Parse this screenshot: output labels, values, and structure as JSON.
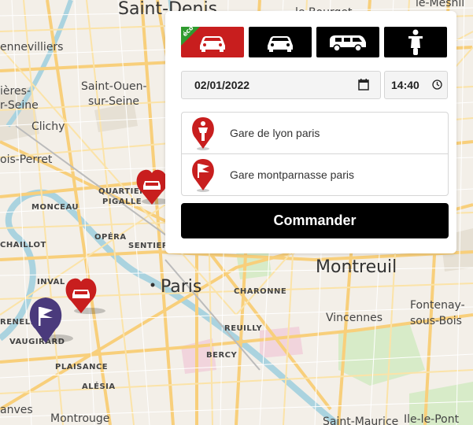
{
  "map": {
    "labels": {
      "saint_denis": "Saint-Denis",
      "bourget": "le Bourget",
      "mesnil": "le-Mesnil",
      "gennevilliers": "ennevilliers",
      "saint_ouen_1": "Saint-Ouen-",
      "saint_ouen_2": "sur-Seine",
      "asnieres_1": "ières-",
      "asnieres_2": "r-Seine",
      "clichy": "Clichy",
      "levallois": "ois-Perret",
      "quartier": "QUARTIER",
      "pigalle": "PIGALLE",
      "monceau": "MONCEAU",
      "opera": "OPÉRA",
      "sentier": "SENTIER",
      "chaillot": "CHAILLOT",
      "montreuil": "Montreuil",
      "paris": "Paris",
      "charonne": "CHARONNE",
      "invalides": "INVAL",
      "grenelle": "RENELLE",
      "vaugirard": "VAUGIRARD",
      "reuilly": "REUILLY",
      "vincennes": "Vincennes",
      "fontenay_1": "Fontenay-",
      "fontenay_2": "sous-Bois",
      "bercy": "BERCY",
      "plaisance": "PLAISANCE",
      "alesia": "ALÉSIA",
      "vanves": "anves",
      "montrouge": "Montrouge",
      "saint_maurice": "Saint-Maurice",
      "ile_le_pont": "Ile-le-Pont"
    }
  },
  "panel": {
    "vehicles": [
      {
        "name": "eco-car",
        "badge": "éco",
        "selected": true
      },
      {
        "name": "car",
        "selected": false
      },
      {
        "name": "van",
        "selected": false
      },
      {
        "name": "scooter",
        "selected": false
      }
    ],
    "date_value": "02/01/2022",
    "time_value": "14:40",
    "pickup": "Gare de lyon paris",
    "dropoff": "Gare montparnasse paris",
    "order_label": "Commander"
  },
  "colors": {
    "accent": "#c81e1e",
    "eco": "#2f9b2f",
    "dark": "#000000",
    "flag_pin": "#4a3a7c"
  }
}
